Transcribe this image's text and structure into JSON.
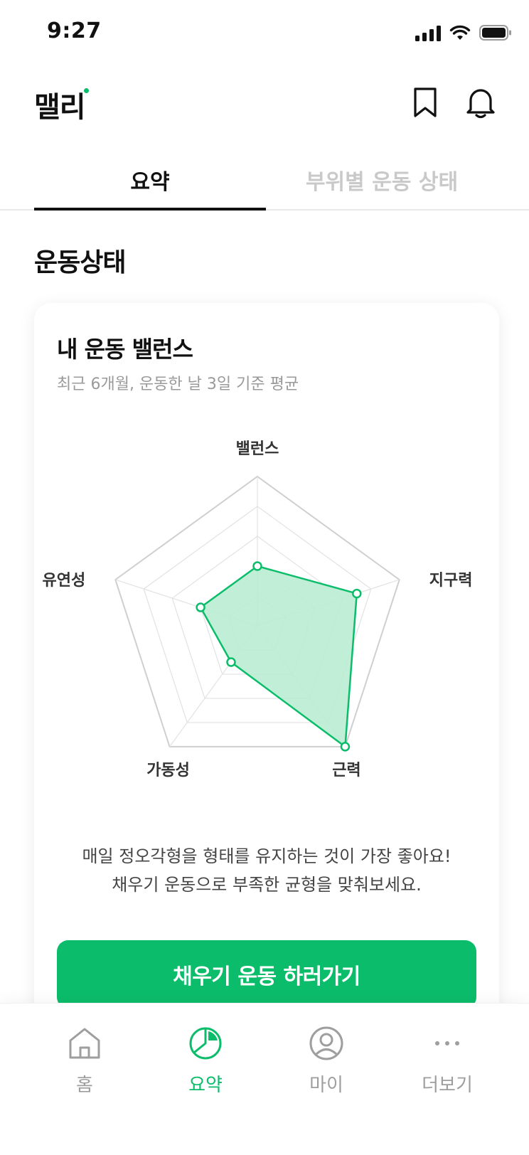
{
  "status_bar": {
    "time": "9:27",
    "icons": [
      "signal-icon",
      "wifi-icon",
      "battery-icon"
    ]
  },
  "header": {
    "logo": "맬리",
    "icons": [
      "bookmark-icon",
      "bell-icon"
    ],
    "accent_color": "#0bbd6a"
  },
  "tabs": [
    {
      "label": "요약",
      "active": true
    },
    {
      "label": "부위별 운동 상태",
      "active": false
    }
  ],
  "section": {
    "title": "운동상태"
  },
  "card": {
    "title": "내 운동 밸런스",
    "subtitle": "최근 6개월, 운동한 날 3일 기준 평균",
    "message_line1": "매일 정오각형을 형태를 유지하는 것이 가장 좋아요!",
    "message_line2": "채우기 운동으로 부족한 균형을 맞춰보세요.",
    "cta_label": "채우기 운동 하러가기"
  },
  "chart_data": {
    "type": "radar",
    "axes": [
      "밸런스",
      "지구력",
      "근력",
      "가동성",
      "유연성"
    ],
    "levels": 5,
    "max": 5,
    "values": [
      2,
      3.5,
      5,
      1.5,
      2
    ],
    "fill_color": "#b9ecd2",
    "line_color": "#0bbd6a"
  },
  "bottom_nav": [
    {
      "label": "홈",
      "icon": "home-icon",
      "active": false
    },
    {
      "label": "요약",
      "icon": "pie-chart-icon",
      "active": true
    },
    {
      "label": "마이",
      "icon": "user-icon",
      "active": false
    },
    {
      "label": "더보기",
      "icon": "more-icon",
      "active": false
    }
  ]
}
